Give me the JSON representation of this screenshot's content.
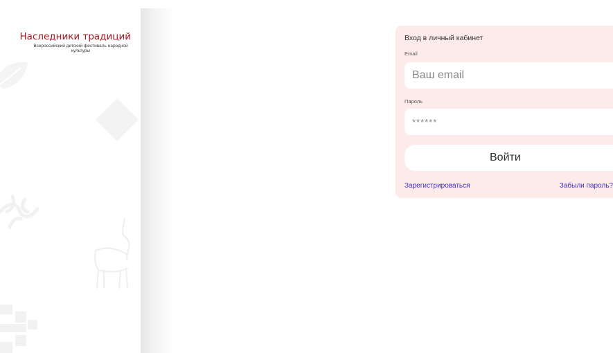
{
  "sidebar": {
    "logo_title": "Наследники традиций",
    "logo_subtitle": "Всероссийский детский фестиваль народной культуры"
  },
  "login": {
    "title": "Вход в личный кабинет",
    "email_label": "Email",
    "email_placeholder": "Ваш email",
    "password_label": "Пароль",
    "password_placeholder": "******",
    "submit_label": "Войти",
    "register_link": "Зарегистрироваться",
    "forgot_link": "Забыли пароль?"
  },
  "colors": {
    "brand_red": "#b3131d",
    "card_background": "#fdebea",
    "link_blue": "#3d2fc8"
  },
  "icons": [
    "leaf-ornament-icon",
    "diamond-ornament-icon",
    "vine-ornament-icon",
    "deer-ornament-icon",
    "cross-ornament-icon"
  ]
}
